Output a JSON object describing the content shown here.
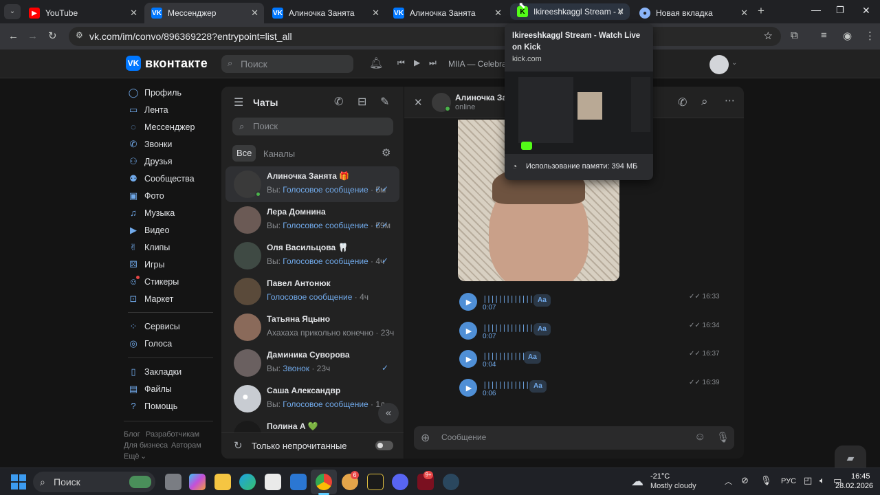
{
  "browser": {
    "tabs": [
      {
        "label": "YouTube",
        "icon": "youtube-icon",
        "color": "#ff0000"
      },
      {
        "label": "Мессенджер",
        "icon": "vk-icon",
        "color": "#0077ff"
      },
      {
        "label": "Алиночка Занята",
        "icon": "vk-icon",
        "color": "#0077ff"
      },
      {
        "label": "Алиночка Занята",
        "icon": "vk-icon",
        "color": "#0077ff"
      },
      {
        "label": "Ikireeshkaggl Stream - Watc",
        "icon": "kick-icon",
        "color": "#53fc18"
      },
      {
        "label": "Новая вкладка",
        "icon": "chrome-icon",
        "color": "#8ab4f8"
      }
    ],
    "url": "vk.com/im/convo/896369228?entrypoint=list_all"
  },
  "tab_preview": {
    "title": "Ikireeshkaggl Stream - Watch Live on Kick",
    "domain": "kick.com",
    "memory": "Использование памяти: 394 МБ"
  },
  "vk": {
    "logo": "вконтакте",
    "search_placeholder": "Поиск",
    "player_text": "MIIA — Celebrate",
    "menu": [
      {
        "label": "Профиль",
        "icon": "profile-icon"
      },
      {
        "label": "Лента",
        "icon": "feed-icon"
      },
      {
        "label": "Мессенджер",
        "icon": "messenger-icon"
      },
      {
        "label": "Звонки",
        "icon": "phone-icon"
      },
      {
        "label": "Друзья",
        "icon": "friends-icon"
      },
      {
        "label": "Сообщества",
        "icon": "communities-icon"
      },
      {
        "label": "Фото",
        "icon": "photo-icon"
      },
      {
        "label": "Музыка",
        "icon": "music-icon"
      },
      {
        "label": "Видео",
        "icon": "video-icon"
      },
      {
        "label": "Клипы",
        "icon": "clips-icon"
      },
      {
        "label": "Игры",
        "icon": "games-icon"
      },
      {
        "label": "Стикеры",
        "icon": "stickers-icon"
      },
      {
        "label": "Маркет",
        "icon": "market-icon"
      },
      {
        "label": "Сервисы",
        "icon": "services-icon"
      },
      {
        "label": "Голоса",
        "icon": "votes-icon"
      },
      {
        "label": "Закладки",
        "icon": "bookmarks-icon"
      },
      {
        "label": "Файлы",
        "icon": "files-icon"
      },
      {
        "label": "Помощь",
        "icon": "help-icon"
      }
    ],
    "footer": {
      "blog": "Блог",
      "dev": "Разработчикам",
      "business": "Для бизнеса",
      "authors": "Авторам",
      "more": "Ещё"
    }
  },
  "chats": {
    "title": "Чаты",
    "search_placeholder": "Поиск",
    "tab_all": "Все",
    "tab_channels": "Каналы",
    "unread_only": "Только непрочитанные",
    "items": [
      {
        "name": "Алиночка Занята 🎁",
        "prefix": "Вы: ",
        "text": "Голосовое сообщение",
        "time": " · 5м",
        "check": "✓✓",
        "avatar": "#3a3a3a"
      },
      {
        "name": "Лера Домнина",
        "prefix": "Вы: ",
        "text": "Голосовое сообщение",
        "time": " · 59м",
        "check": "✓✓",
        "avatar": "#6b5a55"
      },
      {
        "name": "Оля Васильцова 🦷",
        "prefix": "Вы: ",
        "text": "Голосовое сообщение",
        "time": " · 4ч",
        "check": "✓",
        "avatar": "#3f4a44"
      },
      {
        "name": "Павел Антонюк",
        "prefix": "",
        "text": "Голосовое сообщение",
        "time": " · 4ч",
        "check": "",
        "avatar": "#5a4a3a"
      },
      {
        "name": "Татьяна Яцыно",
        "prefix": "",
        "text": "Ахахаха прикольно конечно",
        "time": " · 23ч",
        "check": "",
        "avatar": "#8a6a5a"
      },
      {
        "name": "Даминика Суворова",
        "prefix": "Вы: ",
        "text": "Звонок",
        "time": " · 23ч",
        "check": "✓",
        "avatar": "#6a6060"
      },
      {
        "name": "Саша Александвр",
        "prefix": "Вы: ",
        "text": "Голосовое сообщение",
        "time": " · 1д",
        "check": "",
        "avatar": "#c8ccd2"
      },
      {
        "name": "Полина А 💚",
        "prefix": "",
        "text": "",
        "time": "",
        "check": "",
        "avatar": "#1a1a1a"
      }
    ]
  },
  "conversation": {
    "name": "Алиночка Зан",
    "status": "online",
    "input_placeholder": "Сообщение",
    "voice_messages": [
      {
        "duration": "0:07",
        "aa": "Aa",
        "time": "16:33",
        "wave": "|||||||||||||||||"
      },
      {
        "duration": "0:07",
        "aa": "Aa",
        "time": "16:34",
        "wave": "||||||||||||||||"
      },
      {
        "duration": "0:04",
        "aa": "Aa",
        "time": "16:37",
        "wave": "|||||||||||||"
      },
      {
        "duration": "0:06",
        "aa": "Aa",
        "time": "16:39",
        "wave": "||||||||||||||"
      }
    ]
  },
  "taskbar": {
    "search": "Поиск",
    "weather_temp": "-21°C",
    "weather_desc": "Mostly cloudy",
    "lang": "РУС",
    "time": "16:45",
    "date": "28.02.2026",
    "badge_discord": "6",
    "badge_app": "9+"
  }
}
